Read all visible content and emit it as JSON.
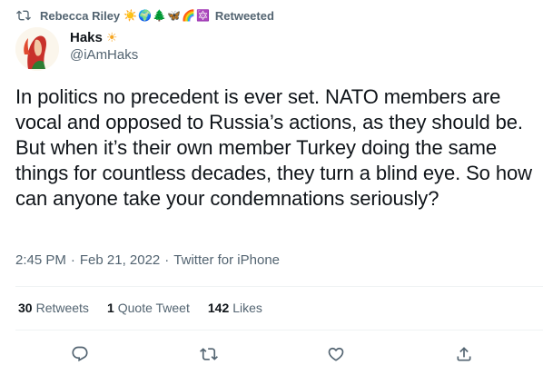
{
  "retweet_context": {
    "user": "Rebecca Riley",
    "emojis": [
      "☀️",
      "🌍",
      "🌲",
      "🦋",
      "🌈",
      "🔯"
    ],
    "suffix": "Retweeted"
  },
  "author": {
    "display_name": "Haks",
    "name_emoji": "☀",
    "handle": "@iAmHaks"
  },
  "tweet": {
    "text": "In politics no precedent is ever set. NATO members are vocal and opposed to Russia’s actions, as they should be. But when it’s their own member Turkey doing the same things for countless decades, they turn a blind eye. So how can anyone take your condemnations seriously?",
    "time": "2:45 PM",
    "separator": "·",
    "date": "Feb 21, 2022",
    "source": "Twitter for iPhone"
  },
  "stats": {
    "retweets": {
      "count": "30",
      "label": "Retweets"
    },
    "quotes": {
      "count": "1",
      "label": "Quote Tweet"
    },
    "likes": {
      "count": "142",
      "label": "Likes"
    }
  },
  "icons": {
    "retweet_context": "retweet-icon",
    "reply": "reply-icon",
    "retweet": "retweet-icon",
    "like": "heart-icon",
    "share": "share-icon"
  },
  "colors": {
    "text_primary": "#0f1419",
    "text_secondary": "#536471",
    "divider": "#eff3f4"
  }
}
